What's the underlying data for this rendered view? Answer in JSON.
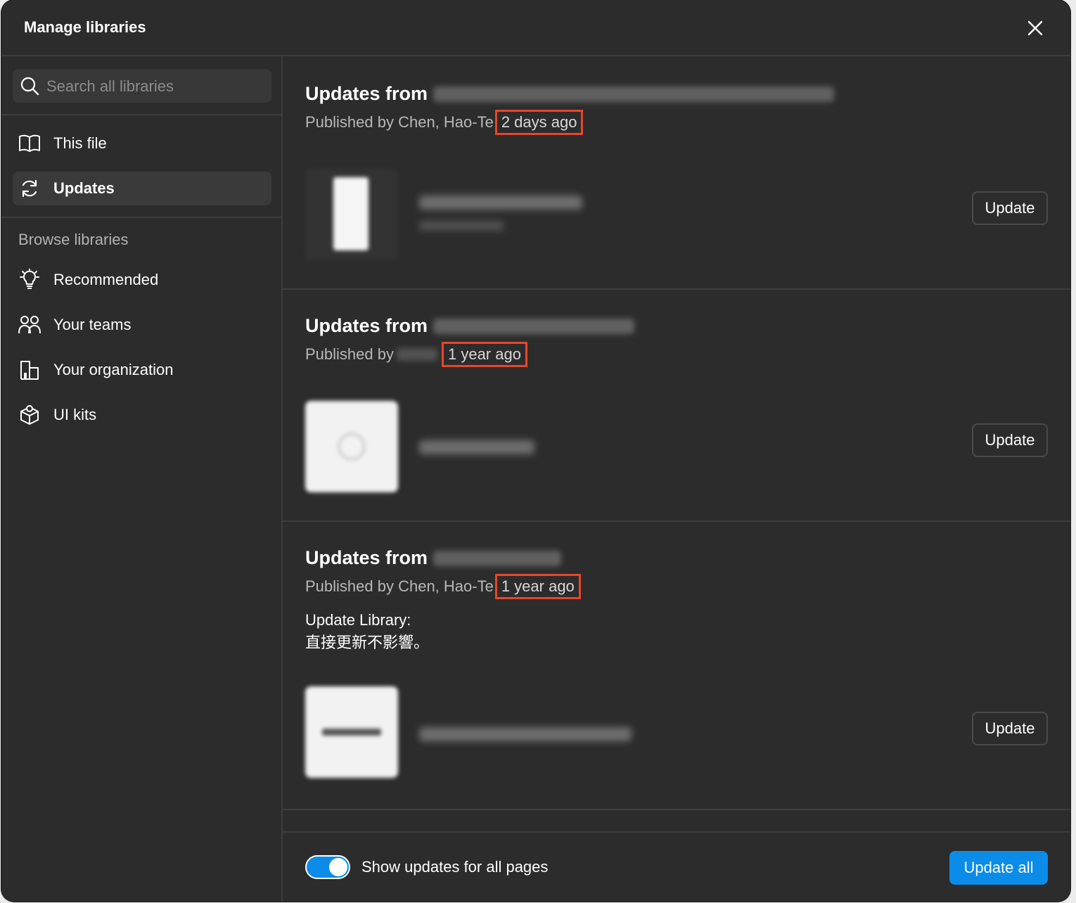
{
  "dialog": {
    "title": "Manage libraries"
  },
  "search": {
    "placeholder": "Search all libraries"
  },
  "sidebar": {
    "top_items": [
      {
        "label": "This file",
        "icon": "book-open-icon"
      },
      {
        "label": "Updates",
        "icon": "refresh-icon",
        "active": true
      }
    ],
    "browse_label": "Browse libraries",
    "browse_items": [
      {
        "label": "Recommended",
        "icon": "lightbulb-icon"
      },
      {
        "label": "Your teams",
        "icon": "people-icon"
      },
      {
        "label": "Your organization",
        "icon": "building-icon"
      },
      {
        "label": "UI kits",
        "icon": "cube-icon"
      }
    ]
  },
  "updates": [
    {
      "heading": "Updates from",
      "published_by": "Published by Chen, Hao-Te",
      "time": "2 days ago",
      "description": "",
      "button": "Update"
    },
    {
      "heading": "Updates from",
      "published_by": "Published by",
      "time": "1 year ago",
      "description": "",
      "button": "Update"
    },
    {
      "heading": "Updates from",
      "published_by": "Published by Chen, Hao-Te",
      "time": "1 year ago",
      "description": "Update Library:\n直接更新不影響。",
      "button": "Update"
    }
  ],
  "footer": {
    "toggle_label": "Show updates for all pages",
    "toggle_on": true,
    "update_all": "Update all"
  },
  "colors": {
    "accent": "#0c8ce9",
    "highlight_box": "#e8462a",
    "background": "#2c2c2c"
  }
}
